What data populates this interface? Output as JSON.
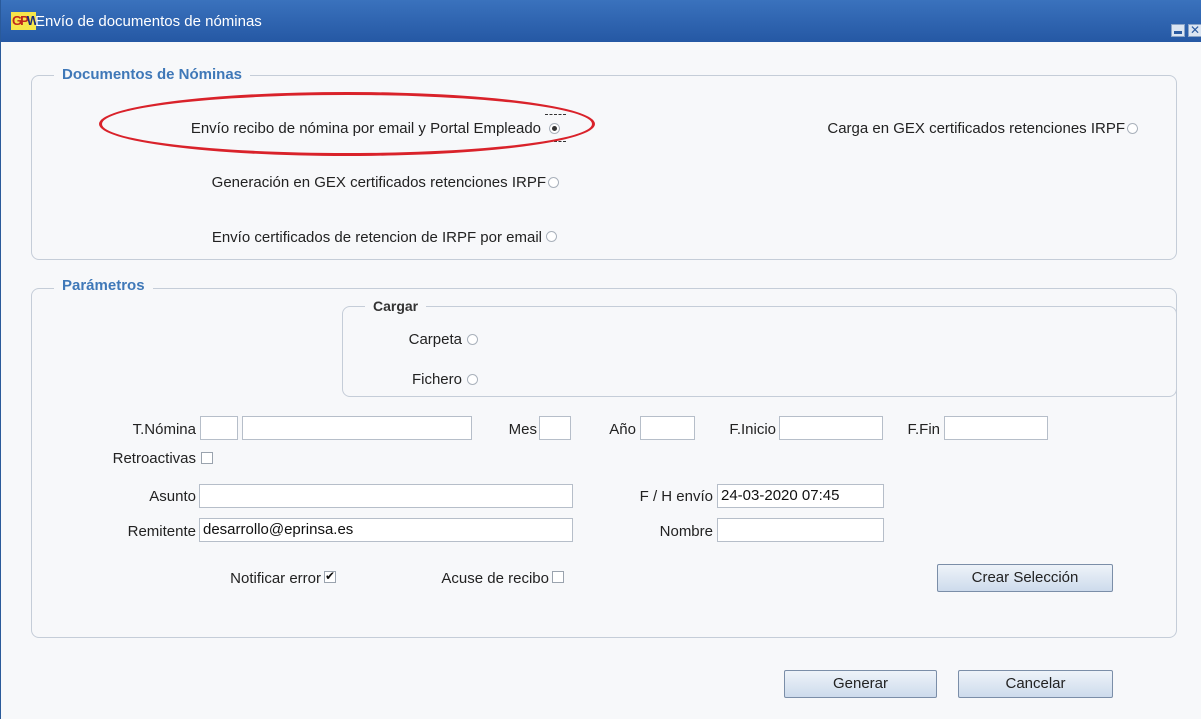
{
  "window": {
    "title": "Envío de documentos de nóminas",
    "logo_g": "GP",
    "logo_w": "W",
    "close_glyph": "✕"
  },
  "documentos": {
    "legend": "Documentos de Nóminas",
    "options": [
      {
        "label": "Envío recibo de nómina por email y Portal Empleado",
        "checked": true
      },
      {
        "label": "Carga en GEX certificados retenciones IRPF",
        "checked": false
      },
      {
        "label": "Generación en GEX certificados retenciones IRPF",
        "checked": false
      },
      {
        "label": "Envío certificados de retencion de IRPF por email",
        "checked": false
      }
    ]
  },
  "parametros": {
    "legend": "Parámetros",
    "cargar": {
      "legend": "Cargar",
      "carpeta": "Carpeta",
      "fichero": "Fichero"
    },
    "t_nomina": "T.Nómina",
    "mes": "Mes",
    "anio": "Año",
    "f_inicio": "F.Inicio",
    "f_fin": "F.Fin",
    "retroactivas": "Retroactivas",
    "asunto": "Asunto",
    "f_h_envio": "F / H envío",
    "f_h_envio_value": "24-03-2020 07:45",
    "remitente": "Remitente",
    "remitente_value": "desarrollo@eprinsa.es",
    "nombre": "Nombre",
    "notificar_error": "Notificar error",
    "notificar_error_checked": true,
    "acuse_recibo": "Acuse de recibo",
    "acuse_recibo_checked": false,
    "crear_seleccion": "Crear Selección"
  },
  "footer": {
    "generar": "Generar",
    "cancelar": "Cancelar"
  },
  "colors": {
    "titlebar": "#2f66b0",
    "legend": "#3f78b8",
    "highlight": "#d9222a"
  }
}
